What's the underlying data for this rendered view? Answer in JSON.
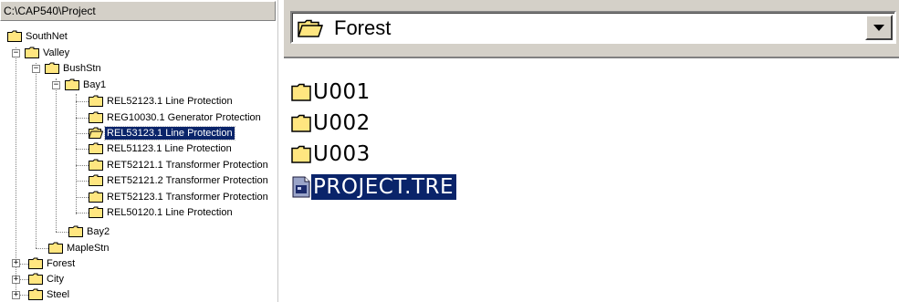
{
  "left_panel": {
    "path": "C:\\CAP540\\Project",
    "tree": [
      {
        "label": "SouthNet",
        "level": 0
      },
      {
        "label": "Valley",
        "level": 0
      },
      {
        "label": "BushStn",
        "level": 1
      },
      {
        "label": "Bay1",
        "level": 2
      },
      {
        "label": "REL52123.1  Line Protection",
        "level": 3
      },
      {
        "label": "REG10030.1  Generator Protection",
        "level": 3
      },
      {
        "label": "REL53123.1  Line Protection",
        "level": 3,
        "selected": true
      },
      {
        "label": "REL51123.1  Line Protection",
        "level": 3
      },
      {
        "label": "RET52121.1  Transformer Protection",
        "level": 3
      },
      {
        "label": "RET52121.2  Transformer Protection",
        "level": 3
      },
      {
        "label": "RET52123.1  Transformer Protection",
        "level": 3
      },
      {
        "label": "REL50120.1  Line Protection",
        "level": 3
      },
      {
        "label": "Bay2",
        "level": 2
      },
      {
        "label": "MapleStn",
        "level": 1
      },
      {
        "label": "Forest",
        "level": 0
      },
      {
        "label": "City",
        "level": 0
      },
      {
        "label": "Steel",
        "level": 0
      }
    ]
  },
  "right_panel": {
    "combo_value": "Forest",
    "files": [
      {
        "name": "U001",
        "icon": "folder-icon"
      },
      {
        "name": "U002",
        "icon": "folder-icon"
      },
      {
        "name": "U003",
        "icon": "folder-icon"
      },
      {
        "name": "PROJECT.TRE",
        "icon": "tre-file-icon",
        "selected": true
      }
    ]
  },
  "colors": {
    "selection": "#0a246a",
    "folder": "#ffe680",
    "chrome": "#d4d0c8"
  }
}
